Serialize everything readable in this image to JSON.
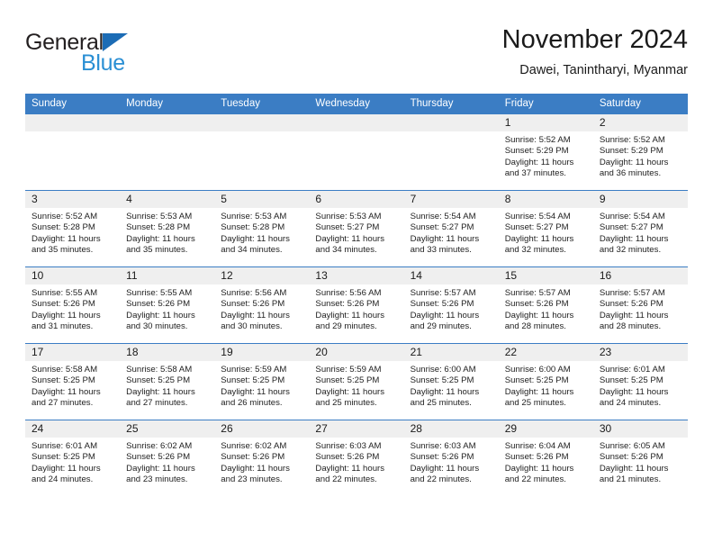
{
  "brand": {
    "name_part1": "General",
    "name_part2": "Blue",
    "triangle_icon": "blue-triangle-icon"
  },
  "header": {
    "title": "November 2024",
    "subtitle": "Dawei, Tanintharyi, Myanmar"
  },
  "colors": {
    "header_blue": "#3b7dc4",
    "brand_blue": "#2a8fd4",
    "triangle_blue": "#1c6cb5",
    "day_band_gray": "#efefef",
    "text_dark": "#1a1a1a"
  },
  "calendar": {
    "weekday_headers": [
      "Sunday",
      "Monday",
      "Tuesday",
      "Wednesday",
      "Thursday",
      "Friday",
      "Saturday"
    ],
    "weeks": [
      [
        {
          "day": "",
          "sunrise": "",
          "sunset": "",
          "daylight_line1": "",
          "daylight_line2": "",
          "empty": true
        },
        {
          "day": "",
          "sunrise": "",
          "sunset": "",
          "daylight_line1": "",
          "daylight_line2": "",
          "empty": true
        },
        {
          "day": "",
          "sunrise": "",
          "sunset": "",
          "daylight_line1": "",
          "daylight_line2": "",
          "empty": true
        },
        {
          "day": "",
          "sunrise": "",
          "sunset": "",
          "daylight_line1": "",
          "daylight_line2": "",
          "empty": true
        },
        {
          "day": "",
          "sunrise": "",
          "sunset": "",
          "daylight_line1": "",
          "daylight_line2": "",
          "empty": true
        },
        {
          "day": "1",
          "sunrise": "Sunrise: 5:52 AM",
          "sunset": "Sunset: 5:29 PM",
          "daylight_line1": "Daylight: 11 hours",
          "daylight_line2": "and 37 minutes."
        },
        {
          "day": "2",
          "sunrise": "Sunrise: 5:52 AM",
          "sunset": "Sunset: 5:29 PM",
          "daylight_line1": "Daylight: 11 hours",
          "daylight_line2": "and 36 minutes."
        }
      ],
      [
        {
          "day": "3",
          "sunrise": "Sunrise: 5:52 AM",
          "sunset": "Sunset: 5:28 PM",
          "daylight_line1": "Daylight: 11 hours",
          "daylight_line2": "and 35 minutes."
        },
        {
          "day": "4",
          "sunrise": "Sunrise: 5:53 AM",
          "sunset": "Sunset: 5:28 PM",
          "daylight_line1": "Daylight: 11 hours",
          "daylight_line2": "and 35 minutes."
        },
        {
          "day": "5",
          "sunrise": "Sunrise: 5:53 AM",
          "sunset": "Sunset: 5:28 PM",
          "daylight_line1": "Daylight: 11 hours",
          "daylight_line2": "and 34 minutes."
        },
        {
          "day": "6",
          "sunrise": "Sunrise: 5:53 AM",
          "sunset": "Sunset: 5:27 PM",
          "daylight_line1": "Daylight: 11 hours",
          "daylight_line2": "and 34 minutes."
        },
        {
          "day": "7",
          "sunrise": "Sunrise: 5:54 AM",
          "sunset": "Sunset: 5:27 PM",
          "daylight_line1": "Daylight: 11 hours",
          "daylight_line2": "and 33 minutes."
        },
        {
          "day": "8",
          "sunrise": "Sunrise: 5:54 AM",
          "sunset": "Sunset: 5:27 PM",
          "daylight_line1": "Daylight: 11 hours",
          "daylight_line2": "and 32 minutes."
        },
        {
          "day": "9",
          "sunrise": "Sunrise: 5:54 AM",
          "sunset": "Sunset: 5:27 PM",
          "daylight_line1": "Daylight: 11 hours",
          "daylight_line2": "and 32 minutes."
        }
      ],
      [
        {
          "day": "10",
          "sunrise": "Sunrise: 5:55 AM",
          "sunset": "Sunset: 5:26 PM",
          "daylight_line1": "Daylight: 11 hours",
          "daylight_line2": "and 31 minutes."
        },
        {
          "day": "11",
          "sunrise": "Sunrise: 5:55 AM",
          "sunset": "Sunset: 5:26 PM",
          "daylight_line1": "Daylight: 11 hours",
          "daylight_line2": "and 30 minutes."
        },
        {
          "day": "12",
          "sunrise": "Sunrise: 5:56 AM",
          "sunset": "Sunset: 5:26 PM",
          "daylight_line1": "Daylight: 11 hours",
          "daylight_line2": "and 30 minutes."
        },
        {
          "day": "13",
          "sunrise": "Sunrise: 5:56 AM",
          "sunset": "Sunset: 5:26 PM",
          "daylight_line1": "Daylight: 11 hours",
          "daylight_line2": "and 29 minutes."
        },
        {
          "day": "14",
          "sunrise": "Sunrise: 5:57 AM",
          "sunset": "Sunset: 5:26 PM",
          "daylight_line1": "Daylight: 11 hours",
          "daylight_line2": "and 29 minutes."
        },
        {
          "day": "15",
          "sunrise": "Sunrise: 5:57 AM",
          "sunset": "Sunset: 5:26 PM",
          "daylight_line1": "Daylight: 11 hours",
          "daylight_line2": "and 28 minutes."
        },
        {
          "day": "16",
          "sunrise": "Sunrise: 5:57 AM",
          "sunset": "Sunset: 5:26 PM",
          "daylight_line1": "Daylight: 11 hours",
          "daylight_line2": "and 28 minutes."
        }
      ],
      [
        {
          "day": "17",
          "sunrise": "Sunrise: 5:58 AM",
          "sunset": "Sunset: 5:25 PM",
          "daylight_line1": "Daylight: 11 hours",
          "daylight_line2": "and 27 minutes."
        },
        {
          "day": "18",
          "sunrise": "Sunrise: 5:58 AM",
          "sunset": "Sunset: 5:25 PM",
          "daylight_line1": "Daylight: 11 hours",
          "daylight_line2": "and 27 minutes."
        },
        {
          "day": "19",
          "sunrise": "Sunrise: 5:59 AM",
          "sunset": "Sunset: 5:25 PM",
          "daylight_line1": "Daylight: 11 hours",
          "daylight_line2": "and 26 minutes."
        },
        {
          "day": "20",
          "sunrise": "Sunrise: 5:59 AM",
          "sunset": "Sunset: 5:25 PM",
          "daylight_line1": "Daylight: 11 hours",
          "daylight_line2": "and 25 minutes."
        },
        {
          "day": "21",
          "sunrise": "Sunrise: 6:00 AM",
          "sunset": "Sunset: 5:25 PM",
          "daylight_line1": "Daylight: 11 hours",
          "daylight_line2": "and 25 minutes."
        },
        {
          "day": "22",
          "sunrise": "Sunrise: 6:00 AM",
          "sunset": "Sunset: 5:25 PM",
          "daylight_line1": "Daylight: 11 hours",
          "daylight_line2": "and 25 minutes."
        },
        {
          "day": "23",
          "sunrise": "Sunrise: 6:01 AM",
          "sunset": "Sunset: 5:25 PM",
          "daylight_line1": "Daylight: 11 hours",
          "daylight_line2": "and 24 minutes."
        }
      ],
      [
        {
          "day": "24",
          "sunrise": "Sunrise: 6:01 AM",
          "sunset": "Sunset: 5:25 PM",
          "daylight_line1": "Daylight: 11 hours",
          "daylight_line2": "and 24 minutes."
        },
        {
          "day": "25",
          "sunrise": "Sunrise: 6:02 AM",
          "sunset": "Sunset: 5:26 PM",
          "daylight_line1": "Daylight: 11 hours",
          "daylight_line2": "and 23 minutes."
        },
        {
          "day": "26",
          "sunrise": "Sunrise: 6:02 AM",
          "sunset": "Sunset: 5:26 PM",
          "daylight_line1": "Daylight: 11 hours",
          "daylight_line2": "and 23 minutes."
        },
        {
          "day": "27",
          "sunrise": "Sunrise: 6:03 AM",
          "sunset": "Sunset: 5:26 PM",
          "daylight_line1": "Daylight: 11 hours",
          "daylight_line2": "and 22 minutes."
        },
        {
          "day": "28",
          "sunrise": "Sunrise: 6:03 AM",
          "sunset": "Sunset: 5:26 PM",
          "daylight_line1": "Daylight: 11 hours",
          "daylight_line2": "and 22 minutes."
        },
        {
          "day": "29",
          "sunrise": "Sunrise: 6:04 AM",
          "sunset": "Sunset: 5:26 PM",
          "daylight_line1": "Daylight: 11 hours",
          "daylight_line2": "and 22 minutes."
        },
        {
          "day": "30",
          "sunrise": "Sunrise: 6:05 AM",
          "sunset": "Sunset: 5:26 PM",
          "daylight_line1": "Daylight: 11 hours",
          "daylight_line2": "and 21 minutes."
        }
      ]
    ]
  }
}
